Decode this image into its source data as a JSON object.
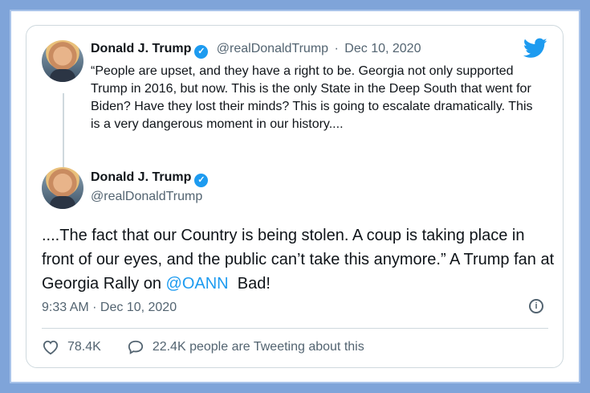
{
  "tweet1": {
    "author_name": "Donald J. Trump",
    "author_handle": "@realDonaldTrump",
    "separator": "·",
    "date": "Dec 10, 2020",
    "text": "“People are upset, and they have a right to be. Georgia not only supported Trump in 2016, but now. This is the only State in the Deep South that went for Biden? Have they lost their minds? This is going to escalate dramatically. This is a very dangerous moment in our history...."
  },
  "tweet2": {
    "author_name": "Donald J. Trump",
    "author_handle": "@realDonaldTrump",
    "text_before": "....The fact that our Country is being stolen. A coup is taking place in front of our eyes, and the public can’t take this anymore.” A Trump fan at Georgia Rally on ",
    "mention": "@OANN",
    "text_after": "  Bad!",
    "timestamp": "9:33 AM · Dec 10, 2020",
    "likes": "78.4K",
    "discussion": "22.4K people are Tweeting about this"
  },
  "icons": {
    "verified": "verified-badge-icon",
    "bird": "twitter-bird-icon",
    "info": "info-icon",
    "heart": "heart-icon",
    "reply": "reply-bubble-icon"
  },
  "colors": {
    "accent": "#1d9bf0",
    "frame": "#7fa4d9",
    "text": "#0f1419",
    "muted": "#536471"
  }
}
